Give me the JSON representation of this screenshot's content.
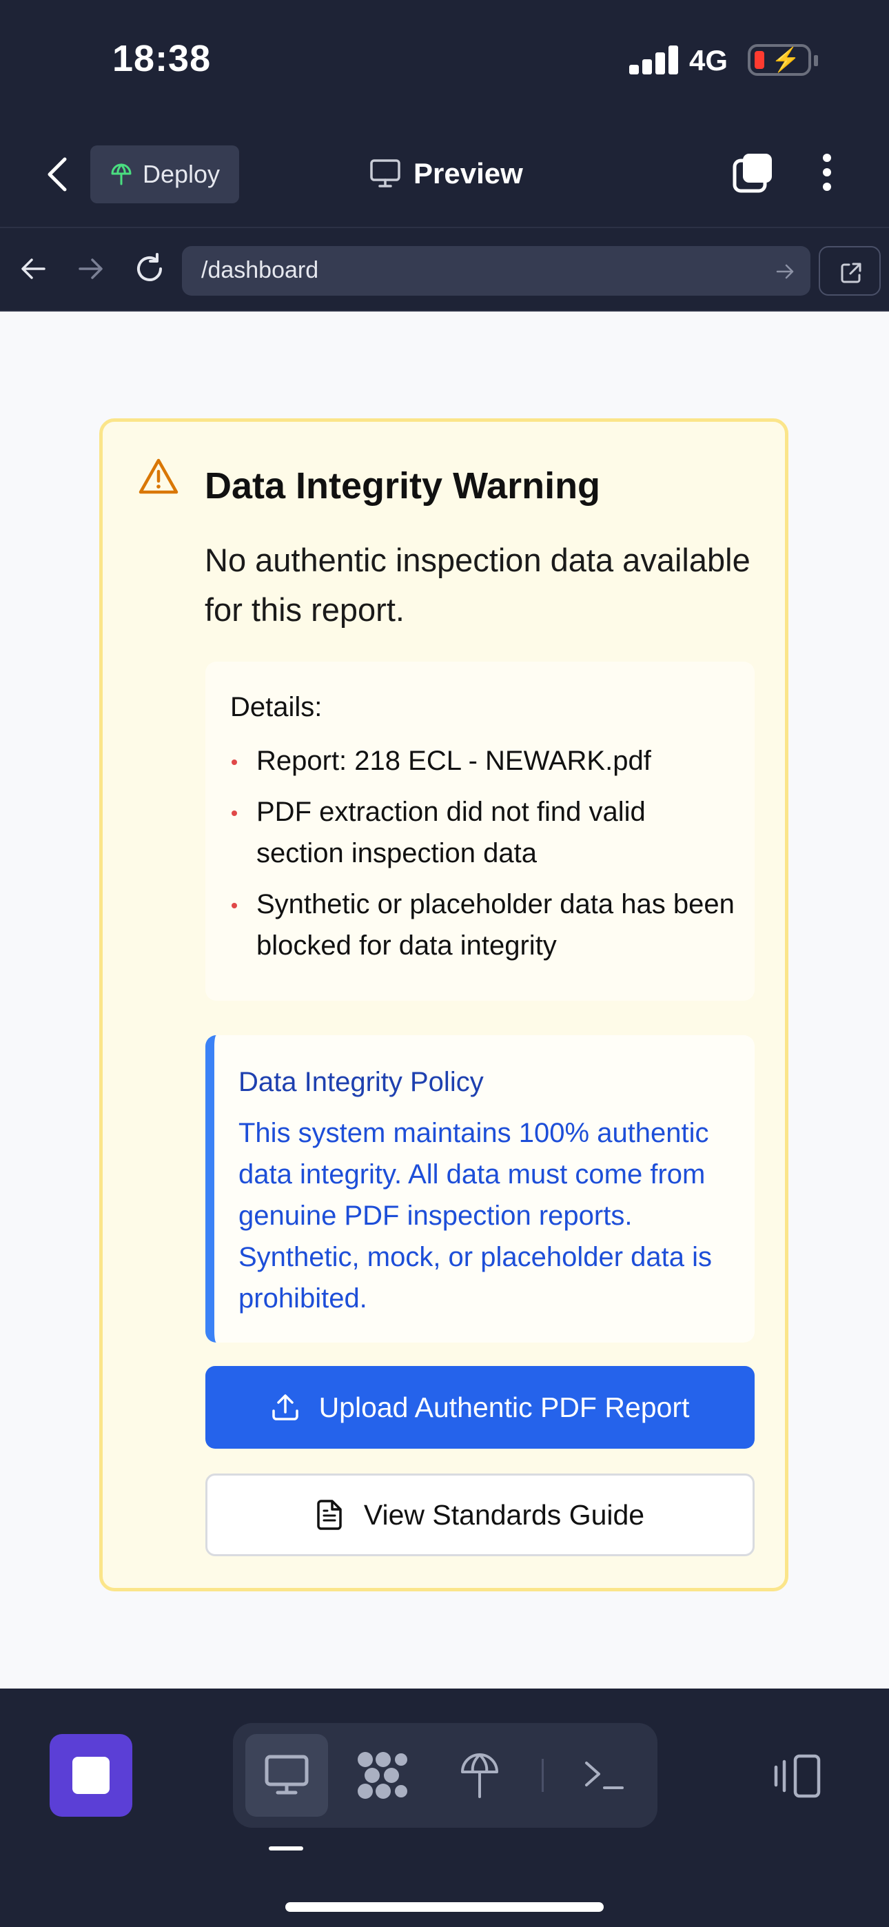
{
  "status_bar": {
    "time": "18:38",
    "network": "4G"
  },
  "header": {
    "deploy_label": "Deploy",
    "preview_label": "Preview"
  },
  "browser": {
    "url": "/dashboard"
  },
  "warning": {
    "title": "Data Integrity Warning",
    "message": "No authentic inspection data available for this report.",
    "details_title": "Details:",
    "details": [
      "Report: 218 ECL - NEWARK.pdf",
      "PDF extraction did not find valid section inspection data",
      "Synthetic or placeholder data has been blocked for data integrity"
    ],
    "policy_title": "Data Integrity Policy",
    "policy_text": "This system maintains 100% authentic data integrity. All data must come from genuine PDF inspection reports. Synthetic, mock, or placeholder data is prohibited.",
    "upload_label": "Upload Authentic PDF Report",
    "guide_label": "View Standards Guide"
  },
  "toolbar": {
    "tools": [
      "desktop-icon",
      "apps-icon",
      "deploy-icon",
      "terminal-icon"
    ],
    "active_tool": "desktop-icon"
  },
  "colors": {
    "chrome_bg": "#1e2336",
    "warning_bg": "#fefbe8",
    "warning_border": "#fbe58a",
    "warning_icon": "#d97706",
    "policy_accent": "#3b82f6",
    "primary_button": "#2563eb",
    "stop_button": "#5b3fd6",
    "bullet": "#e04848"
  }
}
